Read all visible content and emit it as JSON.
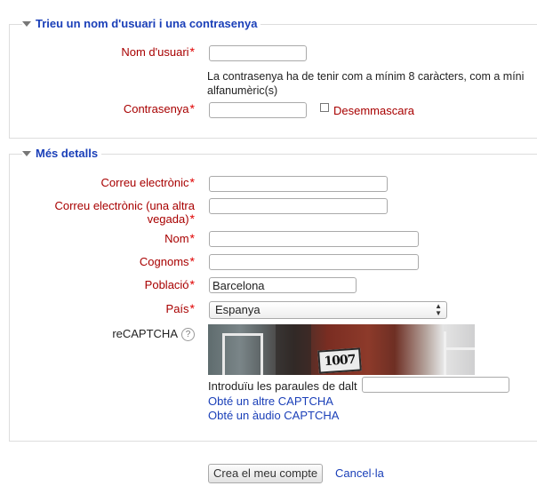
{
  "section_login": {
    "legend": "Trieu un nom d'usuari i una contrasenya",
    "username_label": "Nom d'usuari",
    "username_value": "",
    "password_note_line1": "La contrasenya ha de tenir com a mínim 8 caràcters, com a míni",
    "password_note_line2": "alfanumèric(s)",
    "password_label": "Contrasenya",
    "password_value": "",
    "unmask_label": "Desemmascara"
  },
  "section_details": {
    "legend": "Més detalls",
    "email_label": "Correu electrònic",
    "email_value": "",
    "email2_label_line1": "Correu electrònic (una altra",
    "email2_label_line2": "vegada)",
    "email2_value": "",
    "firstname_label": "Nom",
    "firstname_value": "",
    "lastname_label": "Cognoms",
    "lastname_value": "",
    "city_label": "Població",
    "city_value": "Barcelona",
    "country_label": "País",
    "country_value": "Espanya",
    "recaptcha_label": "reCAPTCHA",
    "captcha_image_text": "1007",
    "captcha_prompt": "Introduïu les paraules de dalt",
    "captcha_value": "",
    "another_captcha_link": "Obté un altre CAPTCHA",
    "audio_captcha_link": "Obté un àudio CAPTCHA"
  },
  "required_marker": "*",
  "help_icon_glyph": "?",
  "actions": {
    "submit_label": "Crea el meu compte",
    "cancel_label": "Cancel·la"
  },
  "colors": {
    "legend": "#1a3fb8",
    "label_required": "#a80000",
    "required_star": "#e00000",
    "link": "#1a3fb8"
  }
}
